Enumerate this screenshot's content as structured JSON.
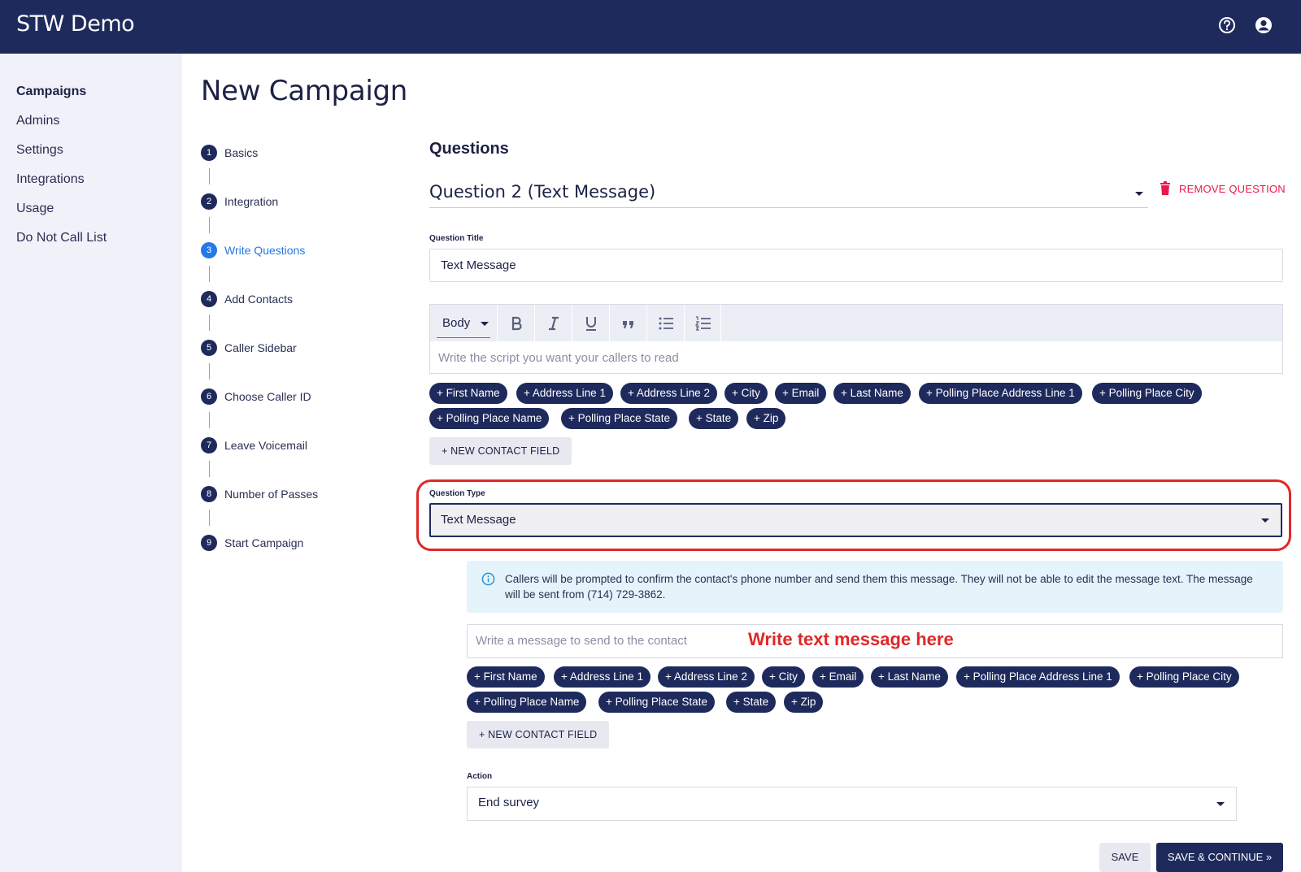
{
  "header": {
    "brand": "STW Demo",
    "icons": [
      "help-icon",
      "account-icon"
    ]
  },
  "sidebar": {
    "items": [
      {
        "label": "Campaigns",
        "active": true
      },
      {
        "label": "Admins"
      },
      {
        "label": "Settings"
      },
      {
        "label": "Integrations"
      },
      {
        "label": "Usage"
      },
      {
        "label": "Do Not Call List"
      }
    ]
  },
  "page": {
    "title": "New Campaign"
  },
  "stepper": {
    "steps": [
      {
        "num": "1",
        "label": "Basics"
      },
      {
        "num": "2",
        "label": "Integration"
      },
      {
        "num": "3",
        "label": "Write Questions",
        "active": true
      },
      {
        "num": "4",
        "label": "Add Contacts"
      },
      {
        "num": "5",
        "label": "Caller Sidebar"
      },
      {
        "num": "6",
        "label": "Choose Caller ID"
      },
      {
        "num": "7",
        "label": "Leave Voicemail"
      },
      {
        "num": "8",
        "label": "Number of Passes"
      },
      {
        "num": "9",
        "label": "Start Campaign"
      }
    ]
  },
  "questions": {
    "section_title": "Questions",
    "selected_question": "Question 2 (Text Message)",
    "remove_label": "REMOVE QUESTION",
    "title_label": "Question Title",
    "title_value": "Text Message",
    "editor": {
      "block_style": "Body",
      "tools": [
        "bold-icon",
        "italic-icon",
        "underline-icon",
        "quote-icon",
        "bullet-list-icon",
        "numbered-list-icon"
      ],
      "placeholder": "Write the script you want your callers to read"
    },
    "contact_fields": [
      "+ First Name",
      "+ Address Line 1",
      "+ Address Line 2",
      "+ City",
      "+ Email",
      "+ Last Name",
      "+ Polling Place Address Line 1",
      "+ Polling Place City",
      "+ Polling Place Name",
      "+ Polling Place State",
      "+ State",
      "+ Zip"
    ],
    "new_contact_field": "+ NEW CONTACT FIELD",
    "type_label": "Question Type",
    "type_value": "Text Message",
    "info_text": "Callers will be prompted to confirm the contact's phone number and send them this message. They will not be able to edit the message text. The message will be sent from (714) 729-3862.",
    "message_placeholder": "Write a message to send to the contact",
    "annotation": "Write text message here",
    "action_label": "Action",
    "action_value": "End survey"
  },
  "footer": {
    "save": "SAVE",
    "save_continue": "SAVE & CONTINUE »"
  },
  "colors": {
    "navy": "#1f2a5c",
    "accent": "#2579e8",
    "danger": "#e8194f",
    "annotation": "#e02727",
    "sidebar_bg": "#f1f1f9",
    "info_bg": "#e5f3fb"
  }
}
